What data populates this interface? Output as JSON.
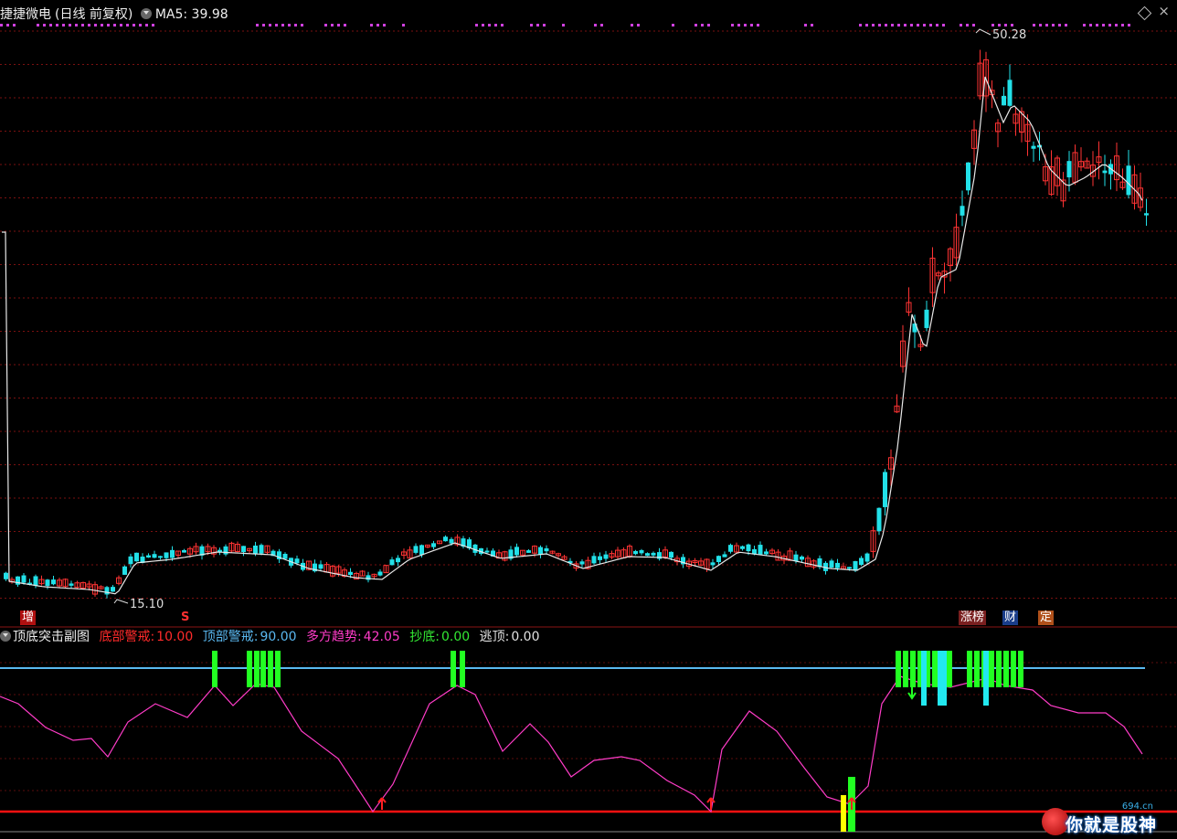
{
  "header": {
    "stock_name": "捷捷微电",
    "period": "(日线 前复权)",
    "ma_label": "MA5: 39.98"
  },
  "price_panel": {
    "high_mark": "50.28",
    "low_mark": "15.10",
    "badge_zeng": "增",
    "badge_s": "S",
    "badge_zhangbang": "涨榜",
    "badge_cai": "财",
    "badge_ding": "定",
    "colors": {
      "up": "#ff3333",
      "down": "#22e0e8",
      "ma": "#e8e8e8",
      "grid": "#7a1010",
      "marks": "#d040e0"
    }
  },
  "sub_panel": {
    "title": "顶底突击副图",
    "items": [
      {
        "label": "底部警戒:",
        "value": "10.00",
        "color": "#ff2a2a"
      },
      {
        "label": "顶部警戒:",
        "value": "90.00",
        "color": "#5ab8f0"
      },
      {
        "label": "多方趋势:",
        "value": "42.05",
        "color": "#ff3cc8"
      },
      {
        "label": "抄底:",
        "value": "0.00",
        "color": "#33e833"
      },
      {
        "label": "逃顶:",
        "value": "0.00",
        "color": "#e0e0e0"
      }
    ],
    "colors": {
      "bottom_line": "#ff1010",
      "top_line": "#5ab8f0",
      "trend": "#ff3cc8",
      "green_bar": "#22ff22",
      "cyan_bar": "#22e8f0",
      "yellow_bar": "#ffff00"
    }
  },
  "watermark": {
    "site": "694.cn",
    "slogan": "你就是股神"
  }
}
